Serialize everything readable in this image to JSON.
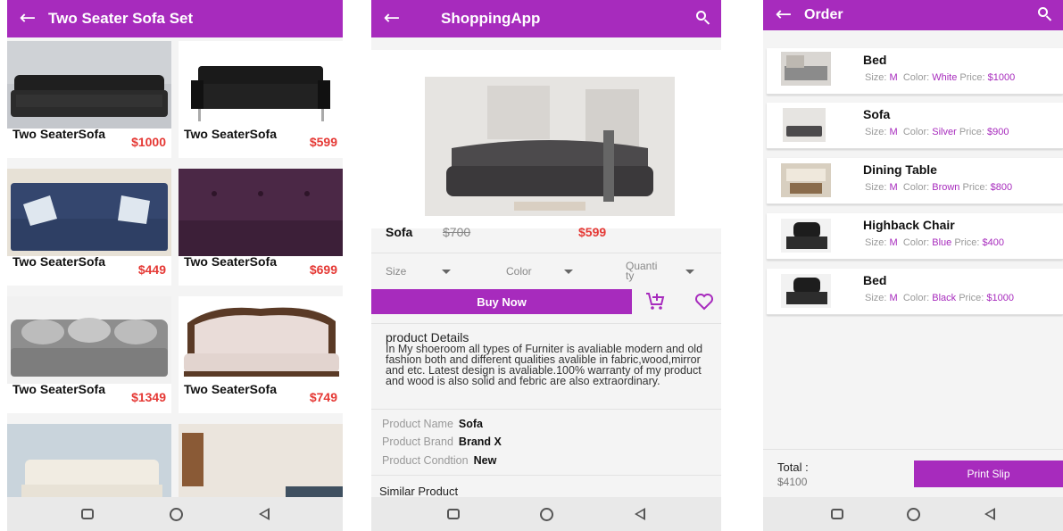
{
  "colors": {
    "primary": "#a72bbd",
    "price_red": "#e53935"
  },
  "screen1": {
    "title": "Two Seater Sofa Set",
    "products": [
      {
        "name": "Two SeaterSofa",
        "price": "$1000"
      },
      {
        "name": "Two SeaterSofa",
        "price": "$599"
      },
      {
        "name": "Two SeaterSofa",
        "price": "$449"
      },
      {
        "name": "Two SeaterSofa",
        "price": "$699"
      },
      {
        "name": "Two SeaterSofa",
        "price": "$1349"
      },
      {
        "name": "Two SeaterSofa",
        "price": "$749"
      },
      {
        "name": "",
        "price": ""
      },
      {
        "name": "",
        "price": ""
      }
    ]
  },
  "screen2": {
    "title": "ShoppingApp",
    "product_name": "Sofa",
    "old_price": "$700",
    "new_price": "$599",
    "size_label": "Size",
    "color_label": "Color",
    "quantity_label": "Quanti\nty",
    "buy_now": "Buy Now",
    "details_heading": "product Details",
    "details_text": "In My shoeroom all types of Furniter is avaliable modern and old fashion both and different qualities avalible in fabric,wood,mirror and etc. Latest design is avaliable.100% warranty of my product and wood is also solid and febric are also extraordinary.",
    "specs": [
      {
        "label": "Product Name",
        "value": "Sofa"
      },
      {
        "label": "Product Brand",
        "value": "Brand X"
      },
      {
        "label": "Product Condtion",
        "value": "New"
      }
    ],
    "similar_heading": "Similar Product"
  },
  "screen3": {
    "title": "Order",
    "orders": [
      {
        "name": "Bed",
        "size": "M",
        "color": "White",
        "price": "$1000"
      },
      {
        "name": "Sofa",
        "size": "M",
        "color": "Silver",
        "price": "$900"
      },
      {
        "name": "Dining Table",
        "size": "M",
        "color": "Brown",
        "price": "$800"
      },
      {
        "name": "Highback Chair",
        "size": "M",
        "color": "Blue",
        "price": "$400"
      },
      {
        "name": "Bed",
        "size": "M",
        "color": "Black",
        "price": "$1000"
      }
    ],
    "size_label": "Size:",
    "color_label": "Color:",
    "price_label": "Price:",
    "total_label": "Total :",
    "total_value": "$4100",
    "print_slip": "Print Slip"
  }
}
